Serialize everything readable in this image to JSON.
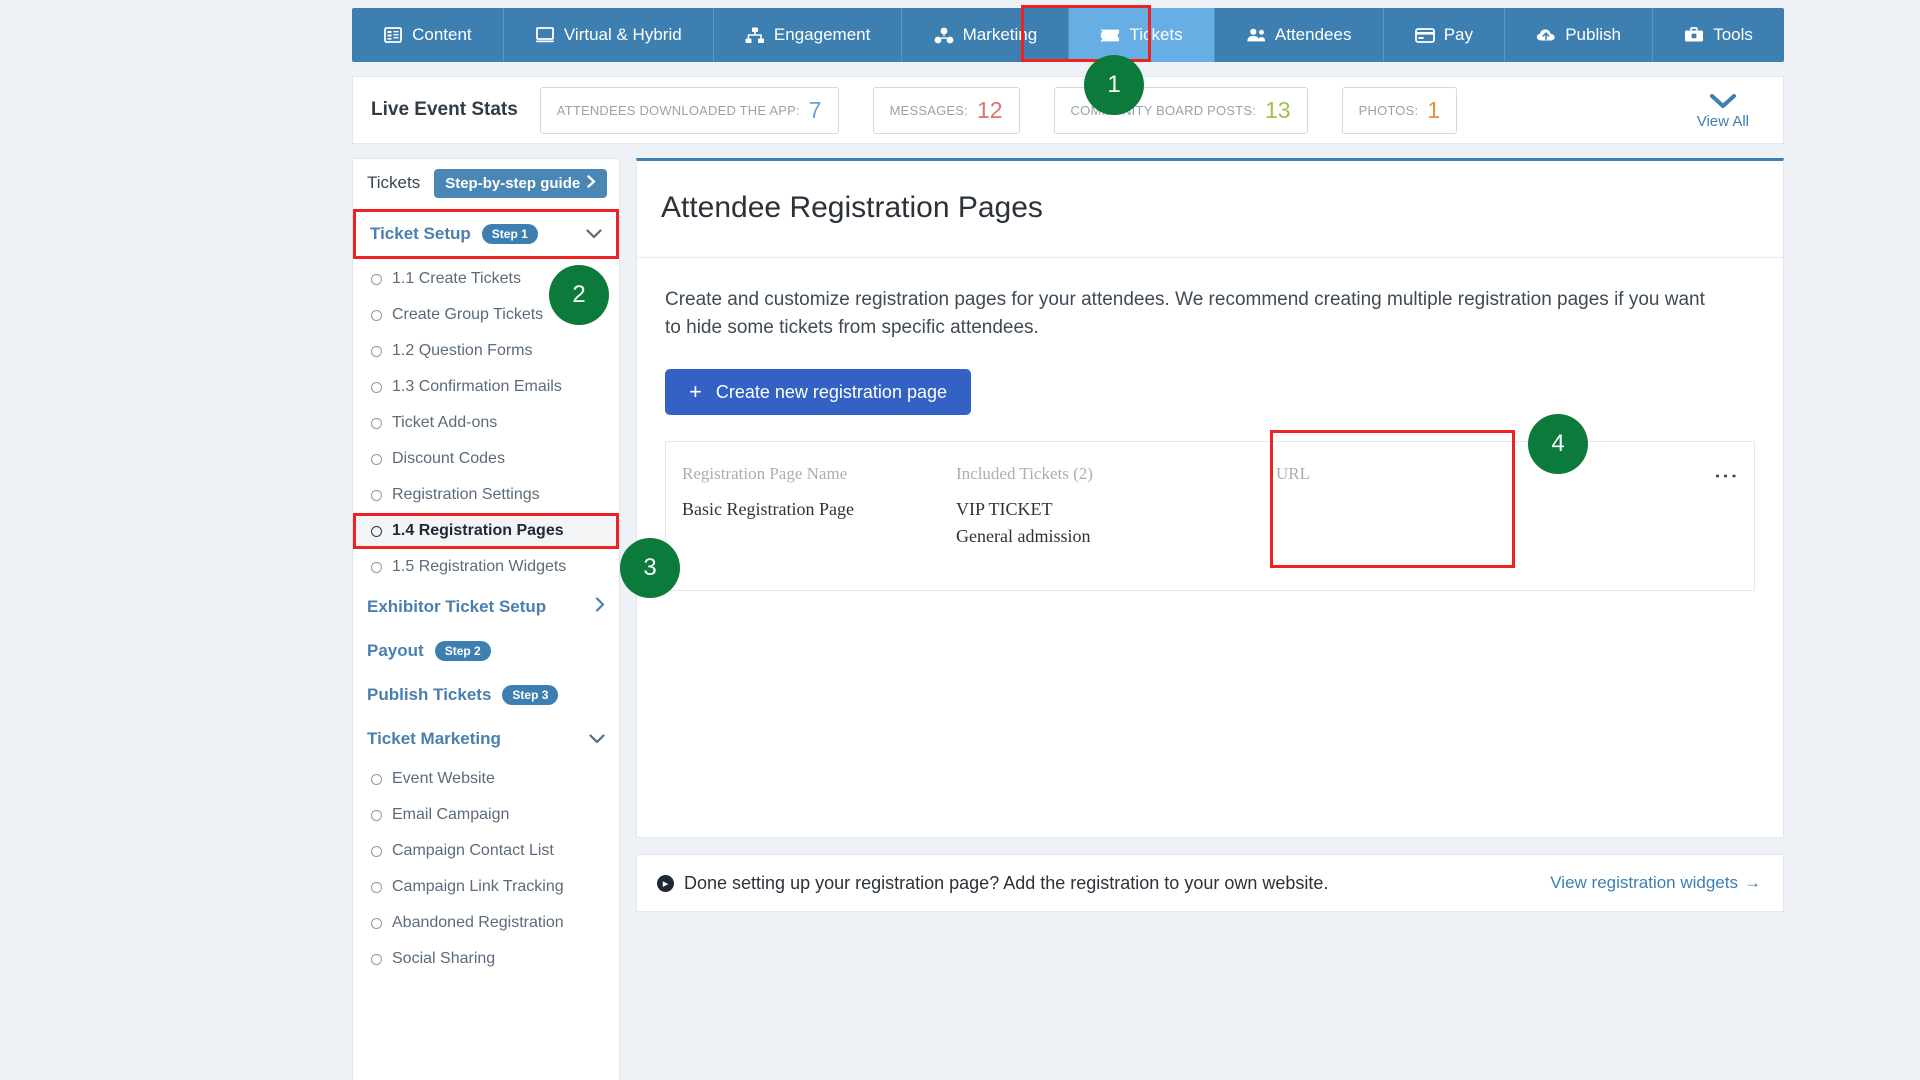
{
  "topnav": {
    "items": [
      {
        "label": "Content",
        "icon": "list-panel-icon",
        "active": false
      },
      {
        "label": "Virtual & Hybrid",
        "icon": "monitor-icon",
        "active": false
      },
      {
        "label": "Engagement",
        "icon": "network-share-icon",
        "active": false
      },
      {
        "label": "Marketing",
        "icon": "share-nodes-icon",
        "active": false
      },
      {
        "label": "Tickets",
        "icon": "ticket-icon",
        "active": true
      },
      {
        "label": "Attendees",
        "icon": "users-icon",
        "active": false
      },
      {
        "label": "Pay",
        "icon": "credit-card-icon",
        "active": false
      },
      {
        "label": "Publish",
        "icon": "cloud-upload-icon",
        "active": false
      },
      {
        "label": "Tools",
        "icon": "toolbox-icon",
        "active": false
      }
    ]
  },
  "stats": {
    "title": "Live Event Stats",
    "boxes": [
      {
        "label": "ATTENDEES DOWNLOADED THE APP:",
        "value": "7",
        "color": "#6f9fd8"
      },
      {
        "label": "MESSAGES:",
        "value": "12",
        "color": "#d9736b"
      },
      {
        "label": "COMMUNITY BOARD POSTS:",
        "value": "13",
        "color": "#9dc34a"
      },
      {
        "label": "PHOTOS:",
        "value": "1",
        "color": "#e0913c"
      }
    ],
    "view_all": "View All",
    "view_all_icon": "chevron-down-icon"
  },
  "sidebar": {
    "header_title": "Tickets",
    "guide_label": "Step-by-step guide",
    "guide_icon": "chevron-right-icon",
    "groups": [
      {
        "label": "Ticket Setup",
        "step": "Step 1",
        "caret": "chevron-down-icon",
        "highlighted": true,
        "items": [
          {
            "label": "1.1 Create Tickets",
            "selected": false
          },
          {
            "label": "Create Group Tickets",
            "selected": false
          },
          {
            "label": "1.2 Question Forms",
            "selected": false
          },
          {
            "label": "1.3 Confirmation Emails",
            "selected": false
          },
          {
            "label": "Ticket Add-ons",
            "selected": false
          },
          {
            "label": "Discount Codes",
            "selected": false
          },
          {
            "label": "Registration Settings",
            "selected": false
          },
          {
            "label": "1.4 Registration Pages",
            "selected": true
          },
          {
            "label": "1.5 Registration Widgets",
            "selected": false
          }
        ]
      },
      {
        "label": "Exhibitor Ticket Setup",
        "step": "",
        "caret": "chevron-right-icon",
        "highlighted": false,
        "items": []
      },
      {
        "label": "Payout",
        "step": "Step 2",
        "caret": "",
        "highlighted": false,
        "items": []
      },
      {
        "label": "Publish Tickets",
        "step": "Step 3",
        "caret": "",
        "highlighted": false,
        "items": []
      },
      {
        "label": "Ticket Marketing",
        "step": "",
        "caret": "chevron-down-icon",
        "highlighted": false,
        "items": [
          {
            "label": "Event Website",
            "selected": false
          },
          {
            "label": "Email Campaign",
            "selected": false
          },
          {
            "label": "Campaign Contact List",
            "selected": false
          },
          {
            "label": "Campaign Link Tracking",
            "selected": false
          },
          {
            "label": "Abandoned Registration",
            "selected": false
          },
          {
            "label": "Social Sharing",
            "selected": false
          }
        ]
      }
    ]
  },
  "main": {
    "title": "Attendee Registration Pages",
    "description": "Create and customize registration pages for your attendees. We recommend creating multiple registration pages if you want to hide some tickets from specific attendees.",
    "create_button": {
      "label": "Create new registration page",
      "icon": "plus-icon"
    },
    "table": {
      "headers": {
        "name": "Registration Page Name",
        "tickets": "Included Tickets (2)",
        "url": "URL"
      },
      "rows": [
        {
          "name": "Basic Registration Page",
          "tickets": [
            "VIP TICKET",
            "General admission"
          ],
          "url": "",
          "menu_icon": "kebab-menu-icon"
        }
      ]
    }
  },
  "footer": {
    "icon": "info-arrow-icon",
    "text": "Done setting up your registration page? Add the registration to your own website.",
    "link": "View registration widgets",
    "link_icon": "arrow-right-icon"
  },
  "annotations": {
    "badges": [
      {
        "id": "badge1",
        "number": "1",
        "target": "tickets-tab"
      },
      {
        "id": "badge2",
        "number": "2",
        "target": "ticket-setup-group"
      },
      {
        "id": "badge3",
        "number": "3",
        "target": "registration-pages-item"
      },
      {
        "id": "badge4",
        "number": "4",
        "target": "url-column"
      }
    ],
    "highlight_color": "#ee2222",
    "badge_color": "#0b7a3b"
  }
}
